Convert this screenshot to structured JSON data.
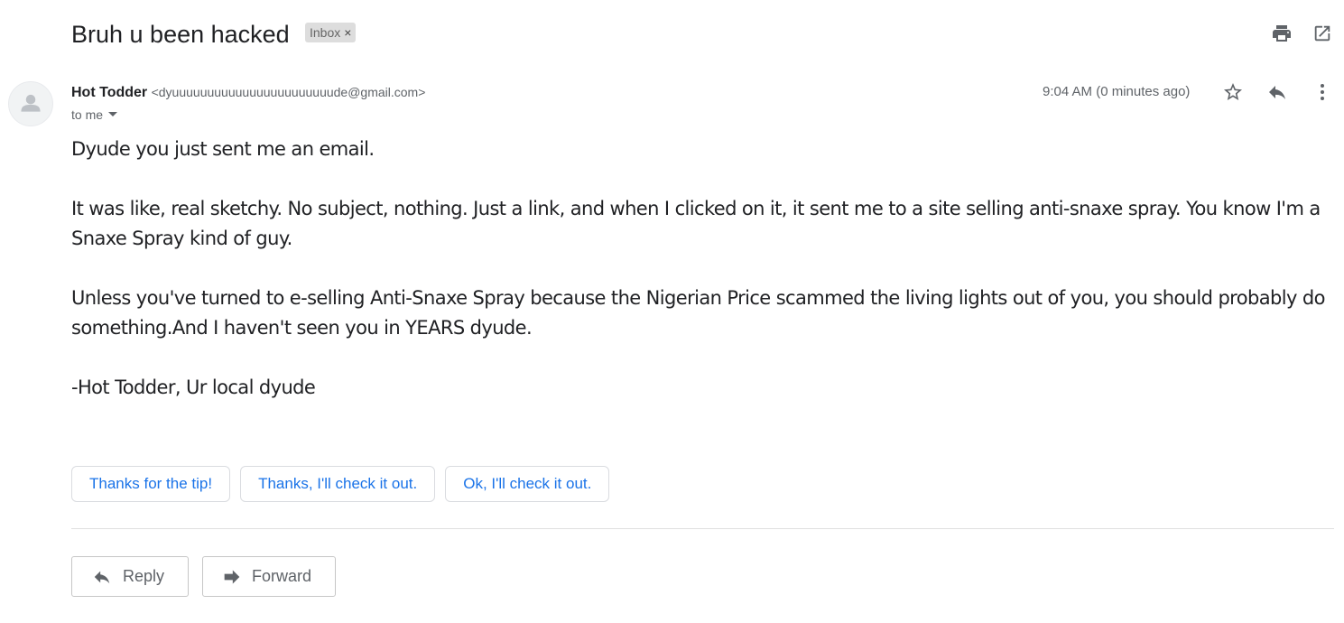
{
  "email": {
    "subject": "Bruh u been hacked",
    "label": "Inbox",
    "label_remove": "×",
    "sender_name": "Hot Todder",
    "sender_email": "<dyuuuuuuuuuuuuuuuuuuuuuuude@gmail.com>",
    "recipient": "to me",
    "timestamp": "9:04 AM (0 minutes ago)",
    "body": [
      "Dyude you just sent me an email.",
      "It was like, real sketchy. No subject, nothing. Just a link, and when I clicked on it, it sent me to a site selling anti-snaxe spray. You know I'm a Snaxe Spray kind of guy.",
      "Unless you've turned to e-selling Anti-Snaxe Spray because the Nigerian Price scammed the living lights out of you, you should probably do something.And I haven't seen you in YEARS dyude.",
      "-Hot Todder, Ur local dyude"
    ]
  },
  "smart_replies": [
    "Thanks for the tip!",
    "Thanks, I'll check it out.",
    "Ok, I'll check it out."
  ],
  "actions": {
    "reply_label": "Reply",
    "forward_label": "Forward"
  },
  "icons": {
    "print": "print-icon",
    "open_new_window": "open-in-new-window-icon",
    "star": "star-icon",
    "reply": "reply-icon",
    "more": "more-vert-icon",
    "avatar": "default-avatar-icon",
    "dropdown": "dropdown-arrow-icon",
    "forward": "forward-icon"
  },
  "colors": {
    "accent": "#1a73e8",
    "text": "#202124",
    "muted": "#5f6368",
    "label_bg": "#dddddd"
  }
}
